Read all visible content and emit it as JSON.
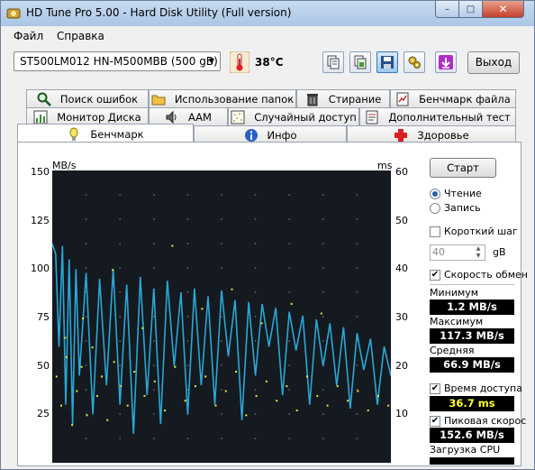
{
  "window": {
    "title": "HD Tune Pro 5.00 - Hard Disk Utility (Full  version)",
    "min": "–",
    "max": "□",
    "close": "✕"
  },
  "menu": [
    {
      "label": "Файл"
    },
    {
      "label": "Справка"
    }
  ],
  "toolbar": {
    "drive": "ST500LM012 HN-M500MBB (500 gB)",
    "temperature": "38°C",
    "exit_label": "Выход",
    "icons": [
      "copy-text-icon",
      "copy-screenshot-icon",
      "save-icon",
      "options-icon",
      "download-icon"
    ]
  },
  "tabs": {
    "row1": [
      {
        "label": "Поиск ошибок",
        "icon": "search-icon"
      },
      {
        "label": "Использование папок",
        "icon": "folder-icon"
      },
      {
        "label": "Стирание",
        "icon": "trash-icon"
      },
      {
        "label": "Бенчмарк файла",
        "icon": "file-benchmark-icon"
      }
    ],
    "row2": [
      {
        "label": "Монитор Диска",
        "icon": "monitor-icon"
      },
      {
        "label": "AAM",
        "icon": "speaker-icon"
      },
      {
        "label": "Случайный доступ",
        "icon": "random-access-icon"
      },
      {
        "label": "Дополнительный  тест",
        "icon": "extra-test-icon"
      }
    ],
    "row3": [
      {
        "label": "Бенчмарк",
        "icon": "benchmark-icon",
        "active": true
      },
      {
        "label": "Инфо",
        "icon": "info-icon"
      },
      {
        "label": "Здоровье",
        "icon": "health-icon"
      }
    ]
  },
  "chart_data": {
    "type": "line",
    "y_left_label": "MB/s",
    "y_right_label": "ms",
    "y_left_ticks": [
      "150",
      "125",
      "100",
      "75",
      "50",
      "25"
    ],
    "y_right_ticks": [
      "60",
      "50",
      "40",
      "30",
      "20",
      "10"
    ],
    "y_left_lim": [
      0,
      150
    ],
    "y_right_lim": [
      0,
      60
    ],
    "x_lim": [
      0,
      500
    ],
    "grid": true,
    "series": [
      {
        "color": "#2aa7d6",
        "x": [
          0,
          5,
          10,
          15,
          20,
          25,
          30,
          35,
          40,
          50,
          60,
          70,
          80,
          90,
          100,
          110,
          120,
          130,
          140,
          150,
          160,
          170,
          180,
          190,
          200,
          210,
          220,
          230,
          240,
          250,
          260,
          270,
          280,
          290,
          300,
          310,
          320,
          330,
          340,
          350,
          360,
          370,
          380,
          390,
          400,
          410,
          420,
          430,
          440,
          450,
          460,
          470,
          480,
          490,
          500
        ],
        "values": [
          113,
          108,
          60,
          112,
          30,
          105,
          20,
          100,
          45,
          98,
          25,
          95,
          40,
          100,
          30,
          92,
          15,
          96,
          35,
          90,
          20,
          94,
          50,
          88,
          25,
          90,
          40,
          86,
          30,
          89,
          55,
          84,
          22,
          83,
          45,
          82,
          60,
          80,
          35,
          78,
          58,
          76,
          30,
          74,
          50,
          72,
          40,
          70,
          28,
          67,
          48,
          64,
          30,
          60,
          45
        ]
      },
      {
        "color": "#e8e83a",
        "scatter": true,
        "x": [
          5,
          12,
          20,
          28,
          35,
          42,
          50,
          58,
          65,
          72,
          80,
          90,
          100,
          110,
          120,
          135,
          150,
          165,
          180,
          195,
          210,
          225,
          240,
          255,
          270,
          285,
          300,
          315,
          330,
          345,
          360,
          375,
          390,
          405,
          420,
          435,
          450,
          465,
          480,
          495,
          18,
          44,
          88,
          132,
          176,
          220,
          264,
          308,
          352,
          396
        ],
        "values": [
          18,
          12,
          22,
          8,
          15,
          20,
          10,
          24,
          14,
          18,
          9,
          21,
          16,
          12,
          19,
          14,
          17,
          11,
          20,
          13,
          16,
          18,
          12,
          15,
          19,
          10,
          14,
          17,
          13,
          16,
          11,
          18,
          14,
          12,
          16,
          13,
          15,
          11,
          14,
          12,
          26,
          30,
          40,
          28,
          45,
          32,
          36,
          29,
          33,
          31
        ]
      }
    ]
  },
  "panel": {
    "start_label": "Старт",
    "read_label": "Чтение",
    "write_label": "Запись",
    "short_step_label": "Короткий шаг",
    "short_step_value": "40",
    "short_step_unit": "gB",
    "speed_change_label": "Скорость обмен",
    "min_label": "Минимум",
    "min_value": "1.2 MB/s",
    "max_label": "Максимум",
    "max_value": "117.3 MB/s",
    "avg_label": "Средняя",
    "avg_value": "66.9 MB/s",
    "access_time_label": "Время доступа",
    "access_time_value": "36.7 ms",
    "burst_label": "Пиковая скорос",
    "burst_value": "152.6 MB/s",
    "cpu_label": "Загрузка CPU"
  }
}
